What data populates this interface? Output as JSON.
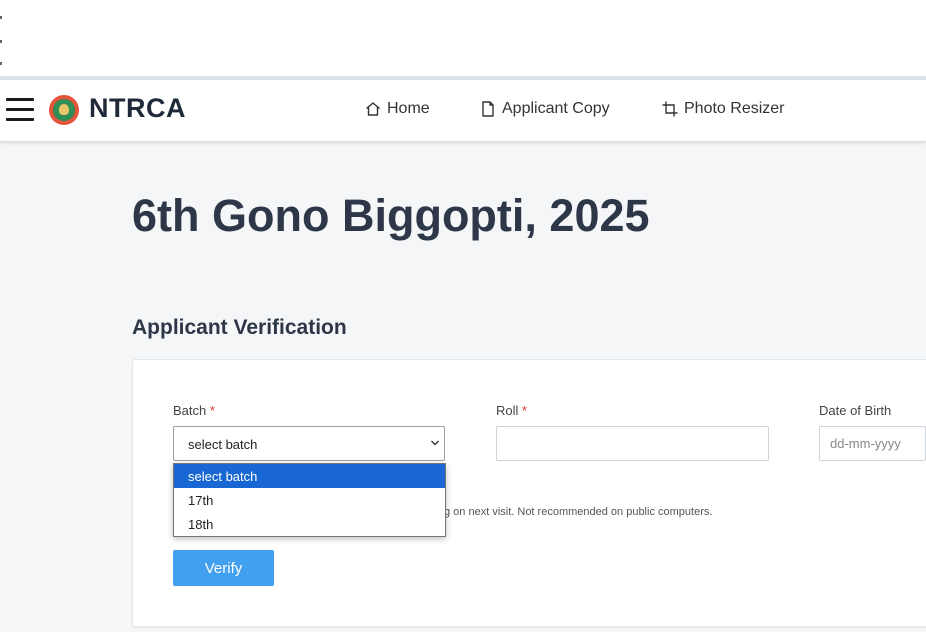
{
  "header": {
    "brand": "NTRCA",
    "nav": [
      {
        "label": "Home",
        "icon": "home-icon"
      },
      {
        "label": "Applicant Copy",
        "icon": "document-icon"
      },
      {
        "label": "Photo Resizer",
        "icon": "crop-icon"
      }
    ]
  },
  "main": {
    "title": "6th Gono Biggopti, 2025",
    "section_title": "Applicant Verification"
  },
  "form": {
    "batch": {
      "label": "Batch",
      "required_mark": "*",
      "value": "select batch",
      "options": [
        "select batch",
        "17th",
        "18th"
      ]
    },
    "roll": {
      "label": "Roll",
      "required_mark": "*",
      "value": ""
    },
    "dob": {
      "label": "Date of Birth",
      "placeholder": "dd-mm-yyyy",
      "value": ""
    },
    "helper_text": "g on next visit. Not recommended on public computers.",
    "verify_label": "Verify"
  },
  "colors": {
    "accent": "#42a0f0",
    "selected_option": "#1967d2",
    "required": "#dd3333",
    "heading": "#2d3748"
  }
}
